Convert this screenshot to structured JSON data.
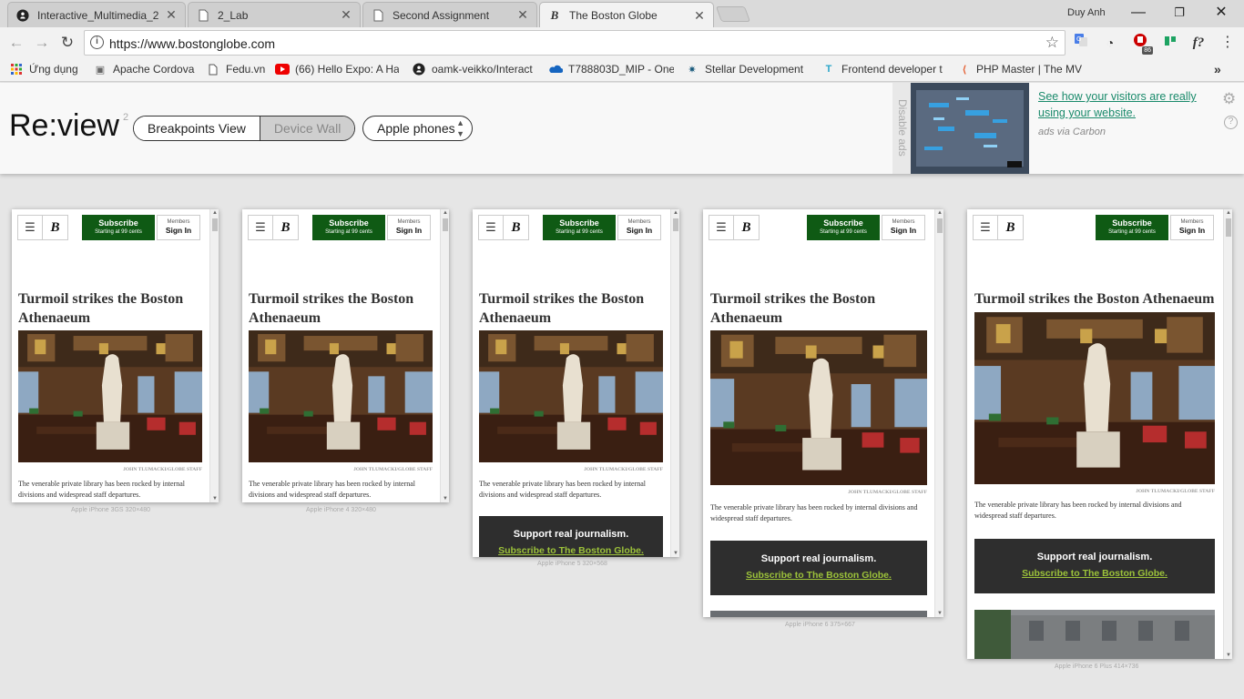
{
  "browser": {
    "tabs": [
      {
        "label": "Interactive_Multimedia_2",
        "icon": "github-icon"
      },
      {
        "label": "2_Lab",
        "icon": "page-icon"
      },
      {
        "label": "Second Assignment",
        "icon": "page-icon"
      },
      {
        "label": "The Boston Globe",
        "icon": "boston-globe-icon",
        "active": true
      }
    ],
    "user": "Duy Anh",
    "url": "https://www.bostonglobe.com",
    "extension_badge": "86",
    "ext_formula": "f?",
    "bookmarks": [
      {
        "label": "Ứng dụng",
        "icon": "apps-icon"
      },
      {
        "label": "Apache Cordova",
        "icon": "cordova-icon"
      },
      {
        "label": "Fedu.vn",
        "icon": "page-icon"
      },
      {
        "label": "(66) Hello Expo: A Ha",
        "icon": "youtube-icon"
      },
      {
        "label": "oamk-veikko/Interact",
        "icon": "github-icon"
      },
      {
        "label": "T788803D_MIP - One",
        "icon": "onedrive-icon"
      },
      {
        "label": "Stellar Development",
        "icon": "stellar-icon"
      },
      {
        "label": "Frontend developer t",
        "icon": "frontend-icon"
      },
      {
        "label": "PHP Master | The MV",
        "icon": "sitepoint-icon"
      }
    ],
    "bookmarks_overflow": "»"
  },
  "review": {
    "logo": "Re:view",
    "version": "2",
    "modes": [
      "Breakpoints View",
      "Device Wall"
    ],
    "selected_mode": "Device Wall",
    "device_select": "Apple phones",
    "disable_ads": "Disable ads",
    "ad_text": "See how your visitors are really using your website.",
    "ad_via": "ads via Carbon"
  },
  "article": {
    "subscribe": "Subscribe",
    "subscribe_sub": "Starting at 99 cents",
    "members": "Members",
    "sign_in": "Sign In",
    "headline": "Turmoil strikes the Boston Athenaeum",
    "credit": "JOHN TLUMACKI/GLOBE STAFF",
    "summary": "The venerable private library has been rocked by internal divisions and widespread staff departures.",
    "promo_title": "Support real journalism.",
    "promo_link": "Subscribe to The Boston Globe."
  },
  "devices": [
    {
      "label": "Apple iPhone 3GS  320×480"
    },
    {
      "label": "Apple iPhone 4  320×480"
    },
    {
      "label": "Apple iPhone 5  320×568"
    },
    {
      "label": "Apple iPhone 6  375×667"
    },
    {
      "label": "Apple iPhone 6 Plus  414×736"
    }
  ]
}
